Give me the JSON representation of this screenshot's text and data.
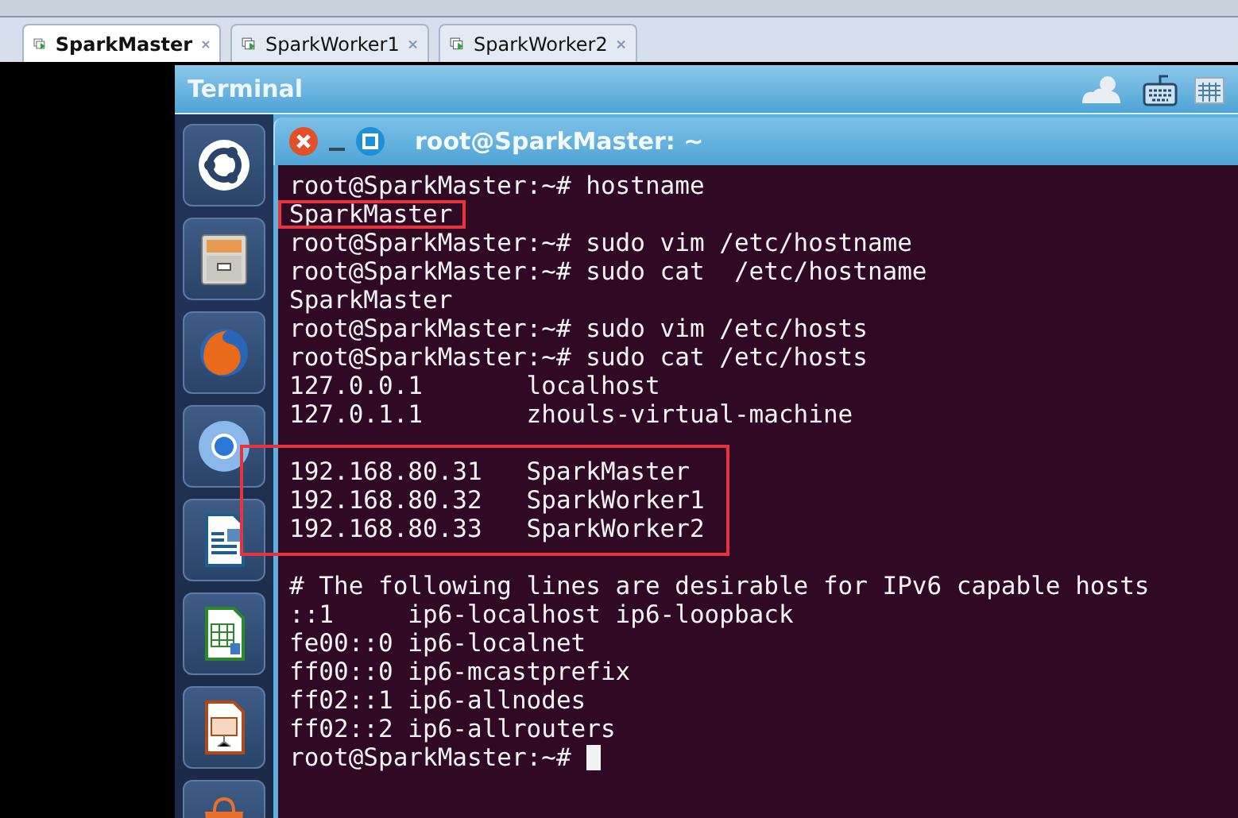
{
  "tabs": [
    {
      "label": "SparkMaster",
      "selected": true
    },
    {
      "label": "SparkWorker1",
      "selected": false
    },
    {
      "label": "SparkWorker2",
      "selected": false
    }
  ],
  "panel": {
    "title": "Terminal"
  },
  "launcher": {
    "items": [
      {
        "kind": "ubuntu"
      },
      {
        "kind": "files"
      },
      {
        "kind": "firefox"
      },
      {
        "kind": "chromium"
      },
      {
        "kind": "writer"
      },
      {
        "kind": "calc"
      },
      {
        "kind": "impress"
      },
      {
        "kind": "store"
      }
    ]
  },
  "terminal": {
    "title": "root@SparkMaster: ~",
    "lines": [
      {
        "kind": "text",
        "text": "root@SparkMaster:~# hostname",
        "highlighted": false
      },
      {
        "kind": "text",
        "text": "SparkMaster",
        "highlighted": true
      },
      {
        "kind": "text",
        "text": "root@SparkMaster:~# sudo vim /etc/hostname",
        "highlighted": false
      },
      {
        "kind": "text",
        "text": "root@SparkMaster:~# sudo cat  /etc/hostname",
        "highlighted": false
      },
      {
        "kind": "text",
        "text": "SparkMaster",
        "highlighted": false
      },
      {
        "kind": "text",
        "text": "root@SparkMaster:~# sudo vim /etc/hosts",
        "highlighted": false
      },
      {
        "kind": "text",
        "text": "root@SparkMaster:~# sudo cat /etc/hosts",
        "highlighted": false
      },
      {
        "kind": "text",
        "text": "127.0.0.1       localhost",
        "highlighted": false
      },
      {
        "kind": "text",
        "text": "127.0.1.1       zhouls-virtual-machine",
        "highlighted": false
      },
      {
        "kind": "blank",
        "highlighted": false
      },
      {
        "kind": "text",
        "text": "192.168.80.31   SparkMaster",
        "highlighted": true
      },
      {
        "kind": "text",
        "text": "192.168.80.32   SparkWorker1",
        "highlighted": true
      },
      {
        "kind": "text",
        "text": "192.168.80.33   SparkWorker2",
        "highlighted": true
      },
      {
        "kind": "blank",
        "highlighted": false
      },
      {
        "kind": "text",
        "text": "# The following lines are desirable for IPv6 capable hosts",
        "highlighted": false
      },
      {
        "kind": "text",
        "text": "::1     ip6-localhost ip6-loopback",
        "highlighted": false
      },
      {
        "kind": "text",
        "text": "fe00::0 ip6-localnet",
        "highlighted": false
      },
      {
        "kind": "text",
        "text": "ff00::0 ip6-mcastprefix",
        "highlighted": false
      },
      {
        "kind": "text",
        "text": "ff02::1 ip6-allnodes",
        "highlighted": false
      },
      {
        "kind": "text",
        "text": "ff02::2 ip6-allrouters",
        "highlighted": false
      },
      {
        "kind": "text",
        "text": "root@SparkMaster:~# ",
        "highlighted": false,
        "cursor": true
      }
    ]
  }
}
